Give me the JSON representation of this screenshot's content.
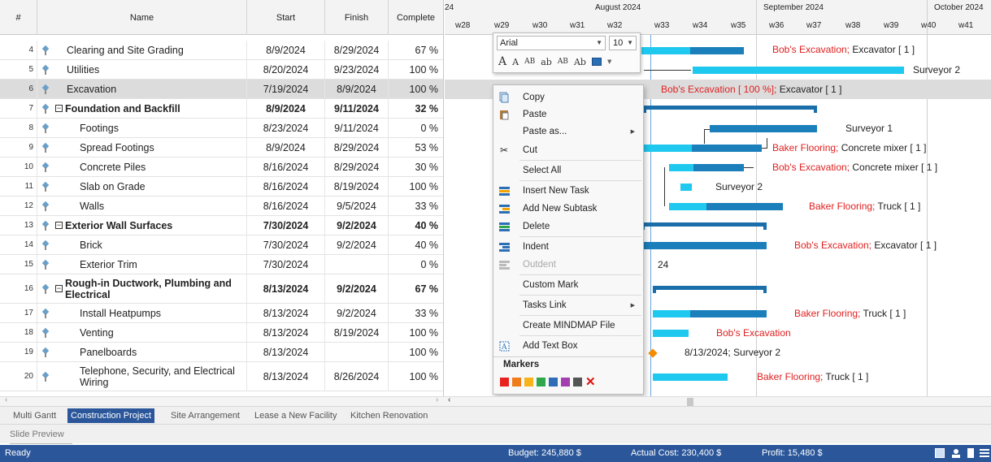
{
  "grid": {
    "headers": {
      "num": "#",
      "name": "Name",
      "start": "Start",
      "finish": "Finish",
      "complete": "Complete"
    },
    "rows": [
      {
        "num": "4",
        "name": "Clearing and Site Grading",
        "start": "8/9/2024",
        "finish": "8/29/2024",
        "complete": "67 %"
      },
      {
        "num": "5",
        "name": "Utilities",
        "start": "8/20/2024",
        "finish": "9/23/2024",
        "complete": "100 %"
      },
      {
        "num": "6",
        "name": "Excavation",
        "start": "7/19/2024",
        "finish": "8/9/2024",
        "complete": "100 %"
      },
      {
        "num": "7",
        "name": "Foundation and Backfill",
        "start": "8/9/2024",
        "finish": "9/11/2024",
        "complete": "32 %"
      },
      {
        "num": "8",
        "name": "Footings",
        "start": "8/23/2024",
        "finish": "9/11/2024",
        "complete": "0 %"
      },
      {
        "num": "9",
        "name": "Spread Footings",
        "start": "8/9/2024",
        "finish": "8/29/2024",
        "complete": "53 %"
      },
      {
        "num": "10",
        "name": "Concrete Piles",
        "start": "8/16/2024",
        "finish": "8/29/2024",
        "complete": "30 %"
      },
      {
        "num": "11",
        "name": "Slab on Grade",
        "start": "8/16/2024",
        "finish": "8/19/2024",
        "complete": "100 %"
      },
      {
        "num": "12",
        "name": "Walls",
        "start": "8/16/2024",
        "finish": "9/5/2024",
        "complete": "33 %"
      },
      {
        "num": "13",
        "name": "Exterior Wall Surfaces",
        "start": "7/30/2024",
        "finish": "9/2/2024",
        "complete": "40 %"
      },
      {
        "num": "14",
        "name": "Brick",
        "start": "7/30/2024",
        "finish": "9/2/2024",
        "complete": "40 %"
      },
      {
        "num": "15",
        "name": "Exterior Trim",
        "start": "7/30/2024",
        "finish": "",
        "complete": "0 %"
      },
      {
        "num": "16",
        "name": "Rough-in Ductwork, Plumbing and Electrical",
        "start": "8/13/2024",
        "finish": "9/2/2024",
        "complete": "67 %"
      },
      {
        "num": "17",
        "name": "Install Heatpumps",
        "start": "8/13/2024",
        "finish": "9/2/2024",
        "complete": "33 %"
      },
      {
        "num": "18",
        "name": "Venting",
        "start": "8/13/2024",
        "finish": "8/19/2024",
        "complete": "100 %"
      },
      {
        "num": "19",
        "name": "Panelboards",
        "start": "8/13/2024",
        "finish": "",
        "complete": "100 %"
      },
      {
        "num": "20",
        "name": "Telephone, Security, and Electrical Wiring",
        "start": "8/13/2024",
        "finish": "8/26/2024",
        "complete": "100 %"
      }
    ]
  },
  "timeline": {
    "months": [
      "24",
      "August 2024",
      "September 2024",
      "October 2024"
    ],
    "weeks": [
      "w28",
      "w29",
      "w30",
      "w31",
      "w32",
      "w33",
      "w34",
      "w35",
      "w36",
      "w37",
      "w38",
      "w39",
      "w40",
      "w41"
    ]
  },
  "gantt_labels": {
    "r4": {
      "res1": "Bob's Excavation;",
      "res2": " Excavator [ 1 ]"
    },
    "r5": {
      "res": "Surveyor 2"
    },
    "r6": {
      "res1": "Bob's Excavation [ 100 %];",
      "res2": " Excavator [ 1 ]"
    },
    "r8": {
      "res": "Surveyor 1"
    },
    "r9": {
      "res1": "Baker Flooring;",
      "res2": " Concrete mixer [ 1 ]"
    },
    "r10": {
      "res1": "Bob's Excavation;",
      "res2": " Concrete mixer [ 1 ]"
    },
    "r11": {
      "res": "Surveyor 2"
    },
    "r12": {
      "res1": "Baker Flooring;",
      "res2": " Truck [ 1 ]"
    },
    "r14": {
      "res1": "Bob's Excavation;",
      "res2": " Excavator [ 1 ]"
    },
    "r15": {
      "res": "24"
    },
    "r17": {
      "res1": "Baker Flooring;",
      "res2": " Truck [ 1 ]"
    },
    "r18": {
      "res": "Bob's Excavation"
    },
    "r19": {
      "res": "8/13/2024;  Surveyor 2"
    },
    "r20": {
      "res1": "Baker Flooring;",
      "res2": " Truck [ 1 ]"
    }
  },
  "toolbar": {
    "font": "Arial",
    "size": "10",
    "grow": "A",
    "shrink": "A",
    "t1": "AB",
    "t2": "ab",
    "t3": "AB",
    "t4": "Ab"
  },
  "context_menu": {
    "copy": "Copy",
    "paste": "Paste",
    "paste_as": "Paste as...",
    "cut": "Cut",
    "select_all": "Select All",
    "insert_task": "Insert New Task",
    "add_subtask": "Add New Subtask",
    "delete": "Delete",
    "indent": "Indent",
    "outdent": "Outdent",
    "custom_mark": "Custom Mark",
    "tasks_link": "Tasks Link",
    "mindmap": "Create MINDMAP File",
    "text_box": "Add Text Box",
    "markers": "Markers"
  },
  "marker_colors": [
    "#e8231f",
    "#f07d1a",
    "#f7b319",
    "#2ea84a",
    "#2f6db5",
    "#a43fb2",
    "#555555"
  ],
  "tabs": [
    "Multi Gantt",
    "Construction Project",
    "Site Arrangement",
    "Lease a New Facility",
    "Kitchen Renovation"
  ],
  "slide_preview": "Slide Preview",
  "status": {
    "ready": "Ready",
    "budget": "Budget: 245,880 $",
    "actual": "Actual Cost: 230,400 $",
    "profit": "Profit: 15,480 $"
  }
}
